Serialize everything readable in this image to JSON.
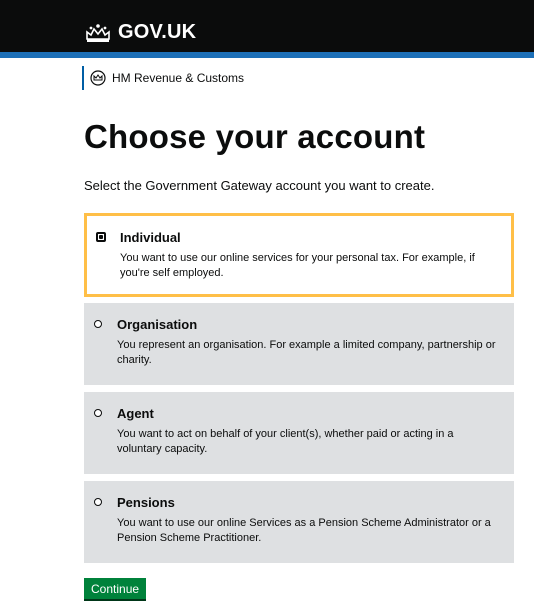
{
  "header": {
    "logo_text": "GOV.UK",
    "crown_icon": "crown-icon",
    "colors": {
      "bar": "#0b0c0c",
      "stripe": "#1d70b8"
    }
  },
  "department": {
    "name": "HM Revenue & Customs",
    "crest_icon": "crest-icon"
  },
  "page": {
    "title": "Choose your account",
    "intro": "Select the Government Gateway account you want to create."
  },
  "options": [
    {
      "title": "Individual",
      "description": "You want to use our online services for your personal tax. For example, if you're self employed.",
      "selected": true
    },
    {
      "title": "Organisation",
      "description": "You represent an organisation. For example a limited company, partnership or charity.",
      "selected": false
    },
    {
      "title": "Agent",
      "description": "You want to act on behalf of your client(s), whether paid or acting in a voluntary capacity.",
      "selected": false
    },
    {
      "title": "Pensions",
      "description": "You want to use our online Services as a Pension Scheme Administrator or a Pension Scheme Practitioner.",
      "selected": false
    }
  ],
  "actions": {
    "continue_label": "Continue",
    "button_color": "#00823b"
  }
}
